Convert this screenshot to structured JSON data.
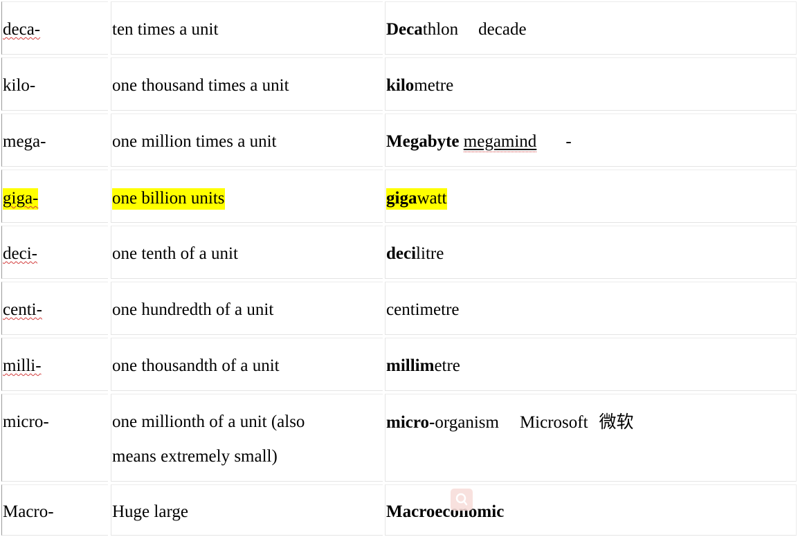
{
  "rows": [
    {
      "prefix": "deca-",
      "meaning": "ten times a unit",
      "ex_bold": "Deca",
      "ex_rest": "thlon",
      "ex_extra": "decade"
    },
    {
      "prefix": "kilo-",
      "meaning": "one thousand times a unit",
      "ex_bold": "kilo",
      "ex_rest": "metre"
    },
    {
      "prefix": "mega-",
      "meaning": "one million times a unit",
      "ex_bold": "Megabyte",
      "ex_extra": "megamind",
      "ex_dash": "-"
    },
    {
      "prefix": "giga-",
      "meaning": "one billion units",
      "ex_bold": "giga",
      "ex_rest": "watt",
      "highlight_color": "#ffff00"
    },
    {
      "prefix": "deci-",
      "meaning": "one tenth of a unit",
      "ex_bold": "deci",
      "ex_rest": "litre"
    },
    {
      "prefix": "centi-",
      "meaning": "one hundredth of a unit",
      "ex_rest": "centimetre"
    },
    {
      "prefix": "milli-",
      "meaning": "one thousandth of a unit",
      "ex_bold": "millim",
      "ex_rest": "etre"
    },
    {
      "prefix": "micro-",
      "meaning_line1": "one millionth of a unit (also",
      "meaning_line2": "means extremely small)",
      "ex_bold": "micro-",
      "ex_rest": "organism",
      "ex_extra": "Microsoft",
      "ex_cjk": "微软"
    },
    {
      "prefix": "Macro-",
      "meaning": "Huge large",
      "ex_bold": "Macroeconomic"
    }
  ],
  "icons": {
    "watermark": "search-icon"
  },
  "colors": {
    "highlight": "#ffff00",
    "spell_underline": "#d23a3a",
    "watermark": "#f7dcd9"
  }
}
